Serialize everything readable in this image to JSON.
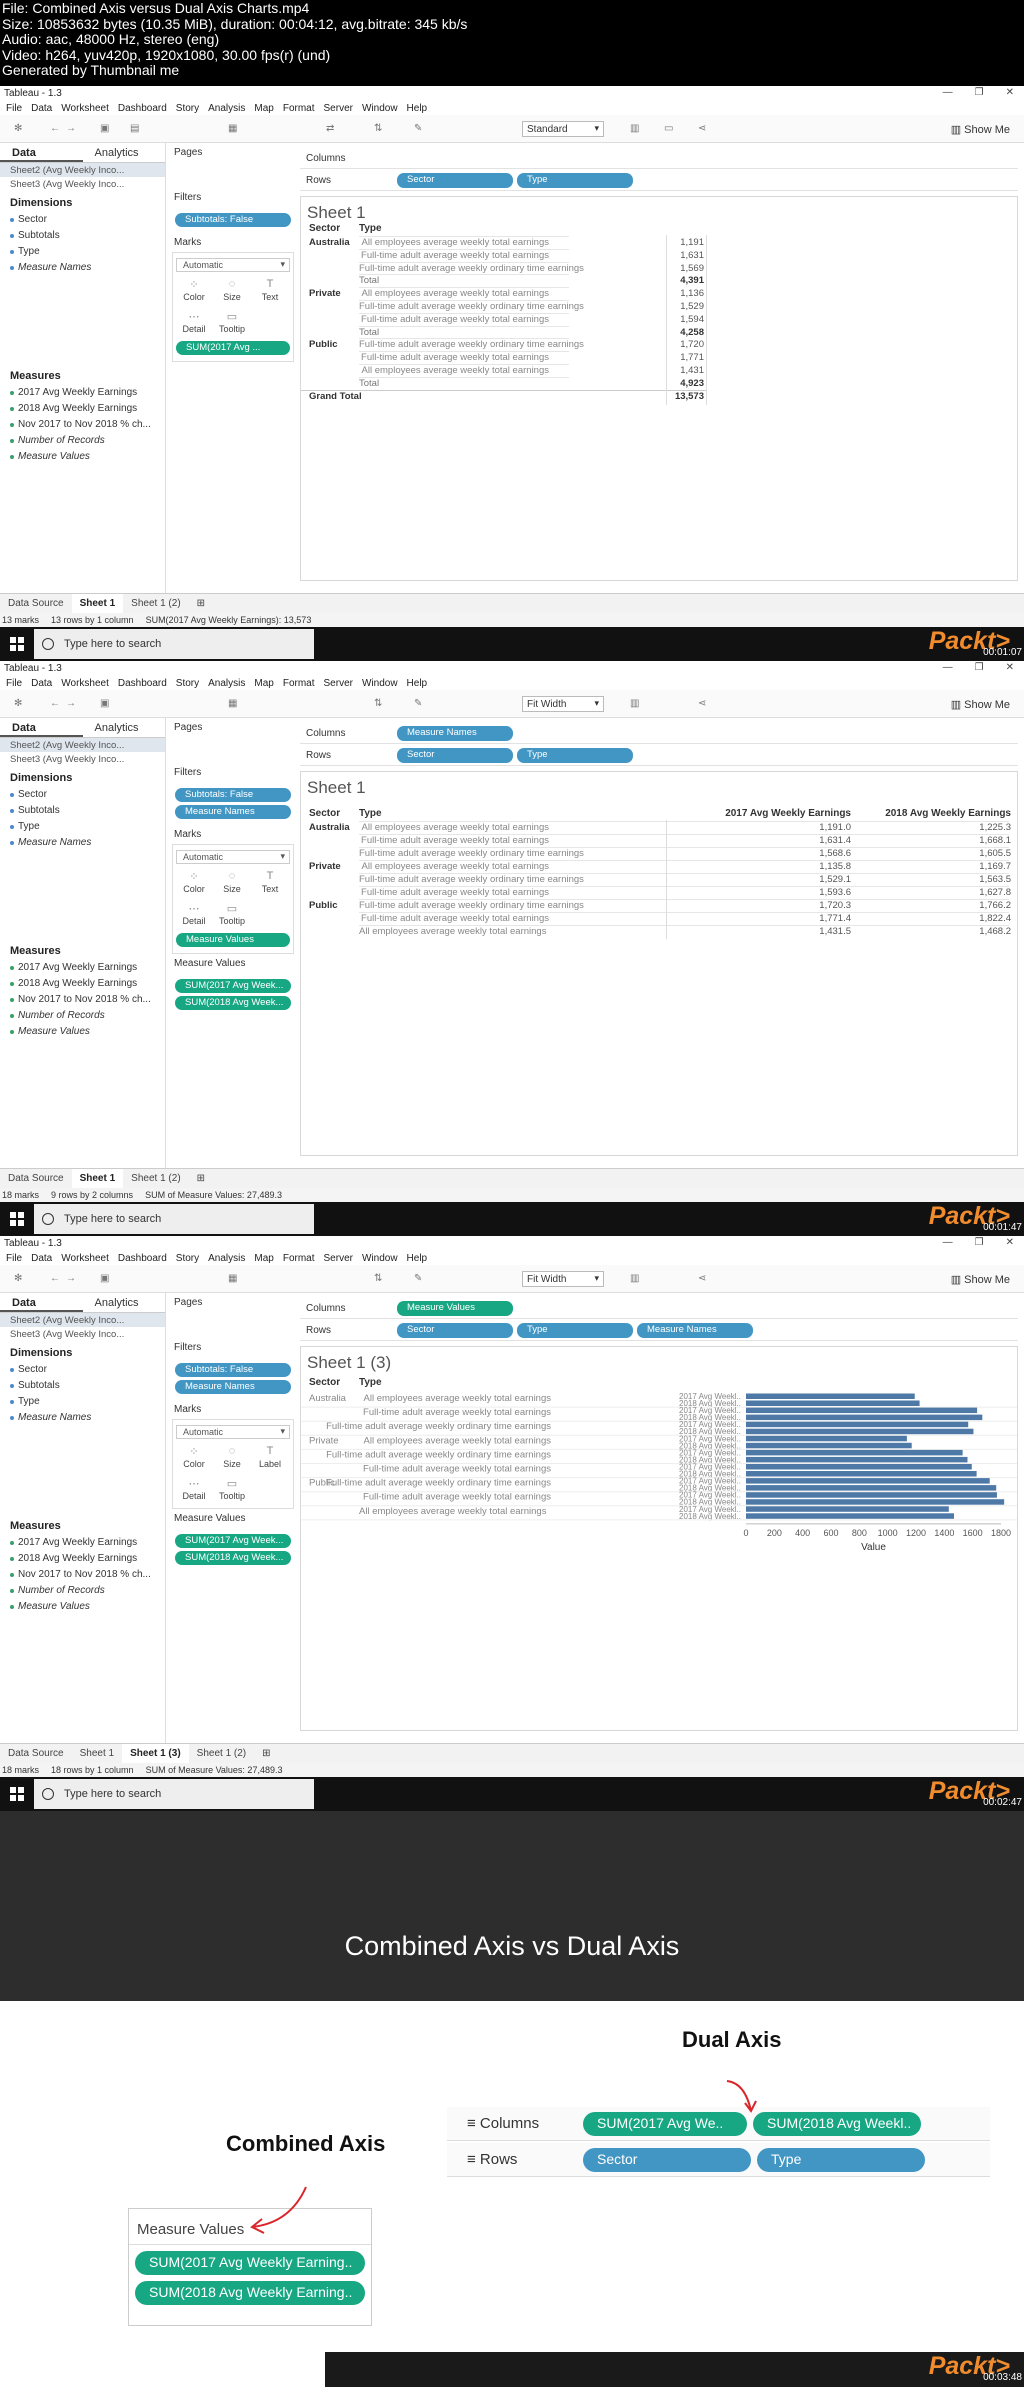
{
  "header": {
    "lines": [
      "File: Combined Axis versus Dual Axis Charts.mp4",
      "Size: 10853632 bytes (10.35 MiB), duration: 00:04:12, avg.bitrate: 345 kb/s",
      "Audio: aac, 48000 Hz, stereo (eng)",
      "Video: h264, yuv420p, 1920x1080, 30.00 fps(r) (und)",
      "Generated by Thumbnail me"
    ]
  },
  "app": {
    "title": "Tableau - 1.3",
    "menu": [
      "File",
      "Data",
      "Worksheet",
      "Dashboard",
      "Story",
      "Analysis",
      "Map",
      "Format",
      "Server",
      "Window",
      "Help"
    ],
    "show_me": "Show Me",
    "data_tab": "Data",
    "analytics_tab": "Analytics",
    "sources": [
      "Sheet2 (Avg Weekly Inco...",
      "Sheet3 (Avg Weekly Inco..."
    ],
    "dimensions_title": "Dimensions",
    "dimensions": [
      "Sector",
      "Subtotals",
      "Type",
      "Measure Names"
    ],
    "measures_title": "Measures",
    "measures": [
      "2017 Avg Weekly Earnings",
      "2018 Avg Weekly Earnings",
      "Nov 2017 to Nov 2018 % ch...",
      "Number of Records",
      "Measure Values"
    ],
    "pages": "Pages",
    "filters": "Filters",
    "marks": "Marks",
    "columns": "Columns",
    "rows": "Rows",
    "mark_buttons": {
      "color": "Color",
      "size": "Size",
      "text": "Text",
      "label": "Label",
      "detail": "Detail",
      "tooltip": "Tooltip"
    },
    "data_source_tab": "Data Source",
    "taskbar_search": "Type here to search",
    "packt": "Packt>",
    "measure_values_card": "Measure Values"
  },
  "frame1": {
    "fit": "Standard",
    "filters": [
      "Subtotals: False"
    ],
    "mark_type": "Automatic",
    "mark_pill": "SUM(2017 Avg ...",
    "rows": [
      "Sector",
      "Type"
    ],
    "sheet_title": "Sheet 1",
    "col_sector": "Sector",
    "col_type": "Type",
    "table": [
      {
        "sector": "Australia",
        "type": "All employees average weekly total earnings",
        "value": "1,191"
      },
      {
        "sector": "",
        "type": "Full-time adult average weekly total earnings",
        "value": "1,631"
      },
      {
        "sector": "",
        "type": "Full-time adult average weekly ordinary time earnings",
        "value": "1,569"
      },
      {
        "sector": "",
        "type": "Total",
        "value": "4,391"
      },
      {
        "sector": "Private",
        "type": "All employees average weekly total earnings",
        "value": "1,136"
      },
      {
        "sector": "",
        "type": "Full-time adult average weekly ordinary time earnings",
        "value": "1,529"
      },
      {
        "sector": "",
        "type": "Full-time adult average weekly total earnings",
        "value": "1,594"
      },
      {
        "sector": "",
        "type": "Total",
        "value": "4,258"
      },
      {
        "sector": "Public",
        "type": "Full-time adult average weekly ordinary time earnings",
        "value": "1,720"
      },
      {
        "sector": "",
        "type": "Full-time adult average weekly total earnings",
        "value": "1,771"
      },
      {
        "sector": "",
        "type": "All employees average weekly total earnings",
        "value": "1,431"
      },
      {
        "sector": "",
        "type": "Total",
        "value": "4,923"
      }
    ],
    "grand_total_label": "Grand Total",
    "grand_total": "13,573",
    "tabs": [
      "Sheet 1",
      "Sheet 1 (2)"
    ],
    "status": [
      "13 marks",
      "13 rows by 1 column",
      "SUM(2017 Avg Weekly Earnings): 13,573"
    ],
    "timestamp": "00:01:07"
  },
  "frame2": {
    "fit": "Fit Width",
    "filters": [
      "Subtotals: False",
      "Measure Names"
    ],
    "mark_type": "Automatic",
    "mark_pill": "Measure Values",
    "columns": [
      "Measure Names"
    ],
    "rows": [
      "Sector",
      "Type"
    ],
    "sheet_title": "Sheet 1",
    "col_sector": "Sector",
    "col_type": "Type",
    "col_2017": "2017 Avg Weekly Earnings",
    "col_2018": "2018 Avg Weekly Earnings",
    "table": [
      {
        "sector": "Australia",
        "type": "All employees average weekly total earnings",
        "v17": "1,191.0",
        "v18": "1,225.3"
      },
      {
        "sector": "",
        "type": "Full-time adult average weekly total earnings",
        "v17": "1,631.4",
        "v18": "1,668.1"
      },
      {
        "sector": "",
        "type": "Full-time adult average weekly ordinary time earnings",
        "v17": "1,568.6",
        "v18": "1,605.5"
      },
      {
        "sector": "Private",
        "type": "All employees average weekly total earnings",
        "v17": "1,135.8",
        "v18": "1,169.7"
      },
      {
        "sector": "",
        "type": "Full-time adult average weekly ordinary time earnings",
        "v17": "1,529.1",
        "v18": "1,563.5"
      },
      {
        "sector": "",
        "type": "Full-time adult average weekly total earnings",
        "v17": "1,593.6",
        "v18": "1,627.8"
      },
      {
        "sector": "Public",
        "type": "Full-time adult average weekly ordinary time earnings",
        "v17": "1,720.3",
        "v18": "1,766.2"
      },
      {
        "sector": "",
        "type": "Full-time adult average weekly total earnings",
        "v17": "1,771.4",
        "v18": "1,822.4"
      },
      {
        "sector": "",
        "type": "All employees average weekly total earnings",
        "v17": "1,431.5",
        "v18": "1,468.2"
      }
    ],
    "measure_pills": [
      "SUM(2017 Avg Week...",
      "SUM(2018 Avg Week..."
    ],
    "tabs": [
      "Sheet 1",
      "Sheet 1 (2)"
    ],
    "status": [
      "18 marks",
      "9 rows by 2 columns",
      "SUM of Measure Values: 27,489.3"
    ],
    "timestamp": "00:01:47"
  },
  "frame3": {
    "fit": "Fit Width",
    "filters": [
      "Subtotals: False",
      "Measure Names"
    ],
    "mark_type": "Automatic",
    "columns": [
      "Measure Values"
    ],
    "rows": [
      "Sector",
      "Type",
      "Measure Names"
    ],
    "sheet_title": "Sheet 1 (3)",
    "col_sector": "Sector",
    "col_type": "Type",
    "measure_pills": [
      "SUM(2017 Avg Week...",
      "SUM(2018 Avg Week..."
    ],
    "tabs": [
      "Sheet 1",
      "Sheet 1 (3)",
      "Sheet 1 (2)"
    ],
    "status": [
      "18 marks",
      "18 rows by 1 column",
      "SUM of Measure Values: 27,489.3"
    ],
    "timestamp": "00:02:47"
  },
  "chart_data": {
    "type": "bar",
    "xlabel": "Value",
    "xlim": [
      0,
      1800
    ],
    "xticks": [
      "0",
      "200",
      "400",
      "600",
      "800",
      "1000",
      "1200",
      "1400",
      "1600",
      "1800"
    ],
    "groups": [
      {
        "sector": "Australia",
        "type": "All employees average weekly total earnings"
      },
      {
        "sector": "",
        "type": "Full-time adult average weekly total earnings"
      },
      {
        "sector": "",
        "type": "Full-time adult average weekly ordinary time earnings"
      },
      {
        "sector": "Private",
        "type": "All employees average weekly total earnings"
      },
      {
        "sector": "",
        "type": "Full-time adult average weekly ordinary time earnings"
      },
      {
        "sector": "",
        "type": "Full-time adult average weekly total earnings"
      },
      {
        "sector": "Public",
        "type": "Full-time adult average weekly ordinary time earnings"
      },
      {
        "sector": "",
        "type": "Full-time adult average weekly total earnings"
      },
      {
        "sector": "",
        "type": "All employees average weekly total earnings"
      }
    ],
    "measure_labels": [
      "2017 Avg Weekl..",
      "2018 Avg Weekl.."
    ],
    "values_2017": [
      1191.0,
      1631.4,
      1568.6,
      1135.8,
      1529.1,
      1593.6,
      1720.3,
      1771.4,
      1431.5
    ],
    "values_2018": [
      1225.3,
      1668.1,
      1605.5,
      1169.7,
      1563.5,
      1627.8,
      1766.2,
      1822.4,
      1468.2
    ],
    "bar_color": "#4e79a7"
  },
  "slide": {
    "title": "Combined Axis vs Dual Axis",
    "dual_label": "Dual Axis",
    "combined_label": "Combined Axis",
    "columns_label": "Columns",
    "rows_label": "Rows",
    "dual_columns": [
      "SUM(2017 Avg We..",
      "SUM(2018 Avg Weekl.."
    ],
    "dual_rows": [
      "Sector",
      "Type"
    ],
    "measure_values_title": "Measure Values",
    "combined_pills": [
      "SUM(2017 Avg Weekly Earning..",
      "SUM(2018 Avg Weekly Earning.."
    ],
    "timestamp": "00:03:48"
  },
  "colors": {
    "blue_pill": "#4196c4",
    "green_pill": "#17a783",
    "accent_arrow": "#d9262b"
  }
}
